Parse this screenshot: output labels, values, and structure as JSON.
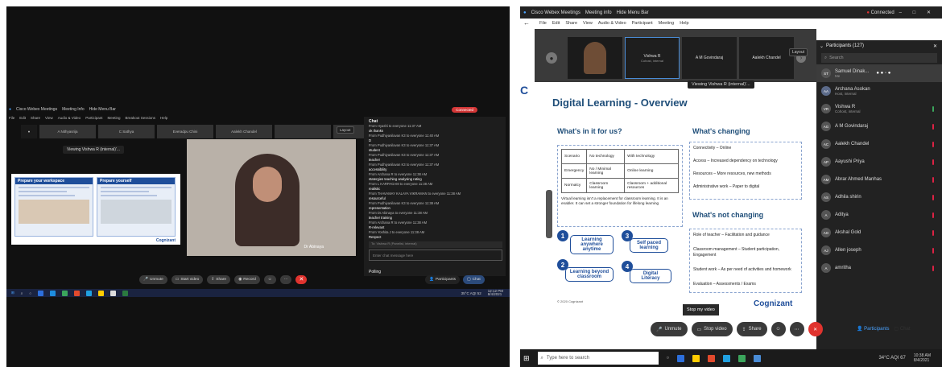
{
  "left": {
    "titlebar": {
      "app": "Cisco Webex Meetings",
      "items": [
        "Meeting Info",
        "Hide Menu Bar"
      ],
      "connected": "Connected"
    },
    "menu": [
      "File",
      "Edit",
      "Share",
      "View",
      "Audio & Video",
      "Participant",
      "Meeting",
      "Breakout Sessions",
      "Help"
    ],
    "tiles": [
      "A Nithyasrija",
      "C Sathya",
      "Everadpu Chini",
      "Aalekh Chandel"
    ],
    "layout": "Layout",
    "viewing": "Viewing Vishwa R (internal)'...",
    "share": {
      "card1": "Prepare your workspace",
      "card2": "Prepare yourself",
      "footer_left": "Cognizant"
    },
    "video_name": "Dr Abinaya",
    "chat": {
      "header": "Chat",
      "lines": [
        "From Hyashi to everyone  11:37 AM",
        "ok thanks",
        "From Pudhiyanilavan K3 to everyone  11:40 AM",
        "D",
        "From Pudhiyanilavan K3 to everyone  11:37 AM",
        "student",
        "From Pudhiyanilavan K3 to everyone  11:37 AM",
        "teacher",
        "From Pudhiyanilavan K3 to everyone  11:37 AM",
        "accessibility",
        "From Archana R to everyone  11:38 AM",
        "statergies teaching analysing rating",
        "From L KARPAGAM to everyone  11:38 AM",
        "realistic",
        "From THAVAMAY KALAYA VIKRAMAN to everyone  11:38 AM",
        "resourceful",
        "From Pudhiyanilavan K3 to everyone  11:38 AM",
        "representation",
        "From Dr.Abinaya to everyone  11:38 AM",
        "teacher training",
        "From Archana R to everyone  11:38 AM",
        "R-relevant",
        "From Yoshita J to everyone  11:38 AM",
        "Respect"
      ],
      "to_label": "To:  Vishwa R (Panelist, internal)",
      "placeholder": "Enter chat message here"
    },
    "polling": "Polling",
    "controls": [
      "Unmute",
      "Start video",
      "Share",
      "Record"
    ],
    "participants": "Participants",
    "chat_btn": "Chat",
    "tray": {
      "weather": "35°C  AQI 52",
      "time": "12:12 PM",
      "date": "8/4/2021"
    }
  },
  "right": {
    "titlebar": {
      "app": "Cisco Webex Meetings",
      "items": [
        "Meeting info",
        "Hide Menu Bar"
      ],
      "connected": "Connected"
    },
    "menu": [
      "File",
      "Edit",
      "Share",
      "View",
      "Audio & Video",
      "Participant",
      "Meeting",
      "Help"
    ],
    "tiles": [
      {
        "name": "Vishwa R",
        "sub": "Cohost, internal"
      },
      {
        "name": "A M Govindaraj",
        "sub": ""
      },
      {
        "name": "Aalekh Chandel",
        "sub": ""
      }
    ],
    "layout": "Layout",
    "viewing": "Viewing Vishwa R (internal)'...",
    "slide": {
      "title": "Digital Learning - Overview",
      "whats_in": "What's in it for us?",
      "table": [
        [
          "Scenario",
          "No technology",
          "With technology"
        ],
        [
          "Emergency",
          "No / Minimal learning",
          "Online learning"
        ],
        [
          "Normalcy",
          "Classroom learning",
          "Classroom + additional resources"
        ]
      ],
      "note": "Virtual learning isn't a replacement for classroom learning.  It is an enabler. It can set a stronger foundation for lifelong learning",
      "bubbles": [
        {
          "n": "1",
          "label": "Learning anywhere anytime"
        },
        {
          "n": "2",
          "label": "Learning beyond classroom"
        },
        {
          "n": "3",
          "label": "Self paced learning"
        },
        {
          "n": "4",
          "label": "Digital Literacy"
        }
      ],
      "changing_title": "What's changing",
      "changing": [
        "Connectivity – Online",
        "Access – Increased dependency on technology",
        "Resources – More resources, new methods",
        "Administrative work – Paper to digital"
      ],
      "not_changing_title": "What's not changing",
      "not_changing": [
        "Role of teacher – Facilitation and guidance",
        "Classroom management – Student participation, Engagement",
        "Student work – As per need of activities and homework",
        "Evaluation – Assessments / Exams"
      ],
      "copyright": "© 2020 Cognizant",
      "logo": "Cognizant",
      "stop_video": "Stop my video"
    },
    "participants": {
      "header": "Participants (127)",
      "search": "Search",
      "list": [
        {
          "initials": "ST",
          "name": "Samuel Dinak...",
          "sub": "Me"
        },
        {
          "initials": "AA",
          "name": "Archana Asokan",
          "sub": "Host, internal"
        },
        {
          "initials": "VR",
          "name": "Vishwa R",
          "sub": "Cohost, internal"
        },
        {
          "initials": "AG",
          "name": "A M Govindaraj",
          "sub": ""
        },
        {
          "initials": "AC",
          "name": "Aalekh Chandel",
          "sub": ""
        },
        {
          "initials": "AP",
          "name": "Aayushi Priya",
          "sub": ""
        },
        {
          "initials": "AM",
          "name": "Abrar Ahmed Manhas",
          "sub": ""
        },
        {
          "initials": "AS",
          "name": "Adhila shirin",
          "sub": ""
        },
        {
          "initials": "A",
          "name": "Aditya",
          "sub": ""
        },
        {
          "initials": "AG",
          "name": "Akshal Gold",
          "sub": ""
        },
        {
          "initials": "AJ",
          "name": "Allen joseph",
          "sub": ""
        },
        {
          "initials": "A",
          "name": "amritha",
          "sub": ""
        }
      ]
    },
    "controls": [
      "Unmute",
      "Stop video",
      "Share"
    ],
    "participants_btn": "Participants",
    "chat_btn": "Chat",
    "taskbar": {
      "search": "Type here to search",
      "weather": "34°C  AQI 67",
      "time": "10:38 AM",
      "date": "8/4/2021"
    }
  }
}
